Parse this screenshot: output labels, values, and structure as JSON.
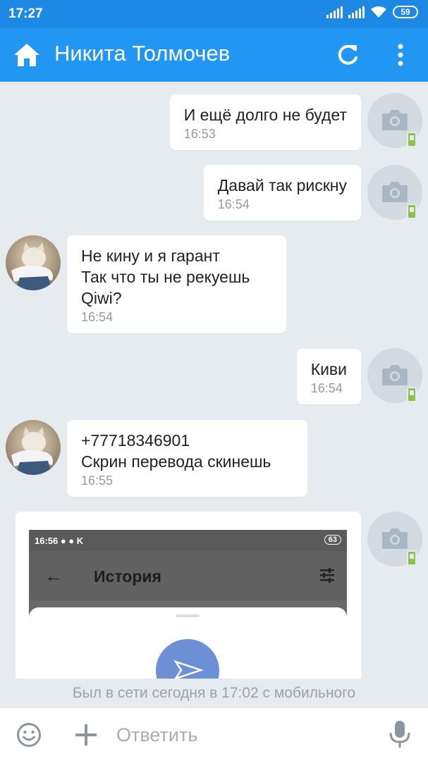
{
  "status_bar": {
    "time": "17:27",
    "battery": "59"
  },
  "header": {
    "title": "Никита Толмочев"
  },
  "messages": [
    {
      "direction": "out",
      "text": "И ещё долго не будет",
      "time": "16:53"
    },
    {
      "direction": "out",
      "text": "Давай так рискну",
      "time": "16:54"
    },
    {
      "direction": "in",
      "text": "Не кину и я гарант\nТак что ты не рекуешь\nQiwi?",
      "time": "16:54"
    },
    {
      "direction": "out",
      "text": "Киви",
      "time": "16:54"
    },
    {
      "direction": "in",
      "text": "+77718346901\nСкрин перевода скинешь",
      "time": "16:55"
    }
  ],
  "attachment": {
    "status_time": "16:56",
    "status_letter": "K",
    "battery": "63",
    "back_glyph": "←",
    "title": "История"
  },
  "footer": {
    "last_seen": "Был в сети сегодня в 17:02 с мобильного",
    "reply_placeholder": "Ответить"
  },
  "icons": {
    "home": "home-icon",
    "refresh": "refresh-icon",
    "more": "more-vertical-icon",
    "emoji": "emoji-icon",
    "attach": "plus-icon",
    "mic": "mic-icon",
    "camera": "camera-icon",
    "mobile": "mobile-badge-icon"
  },
  "colors": {
    "app_bar": "#2196f3",
    "status_bar": "#1e88e5",
    "chat_bg": "#e6ebf0",
    "bubble": "#ffffff",
    "online_mobile": "#8bc34a"
  }
}
